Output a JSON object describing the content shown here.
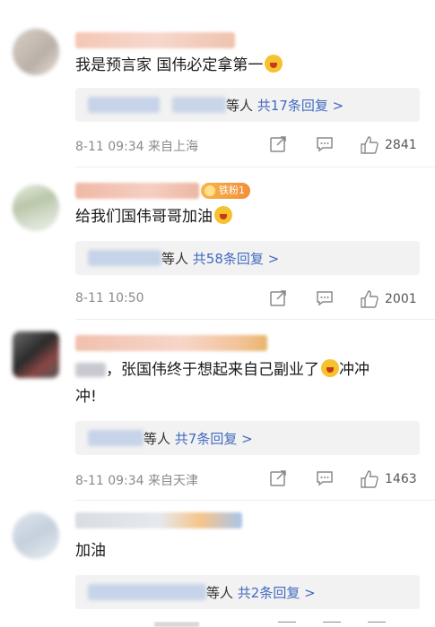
{
  "comments": [
    {
      "text": "我是预言家 国伟必定拿第一",
      "reply_suffix": "等人",
      "reply_link": "共17条回复 >",
      "time": "8-11 09:34  来自上海",
      "likes": "2841"
    },
    {
      "text": "给我们国伟哥哥加油",
      "badge": "铁粉1",
      "reply_suffix": "等人",
      "reply_link": "共58条回复 >",
      "time": "8-11 10:50",
      "likes": "2001"
    },
    {
      "text_prefix": "，张国伟终于想起来自己副业了",
      "text_suffix": "冲冲",
      "text_line2": "冲!",
      "reply_suffix": "等人",
      "reply_link": "共7条回复 >",
      "time": "8-11 09:34  来自天津",
      "likes": "1463"
    },
    {
      "text": "加油",
      "reply_suffix": "等人",
      "reply_link": "共2条回复 >"
    }
  ],
  "icons": {
    "share": "share-icon",
    "comment": "comment-icon",
    "like": "thumbs-up-icon"
  },
  "colors": {
    "link": "#436ac0",
    "meta": "#8a8a8a",
    "reply_bg": "#f2f2f2"
  }
}
